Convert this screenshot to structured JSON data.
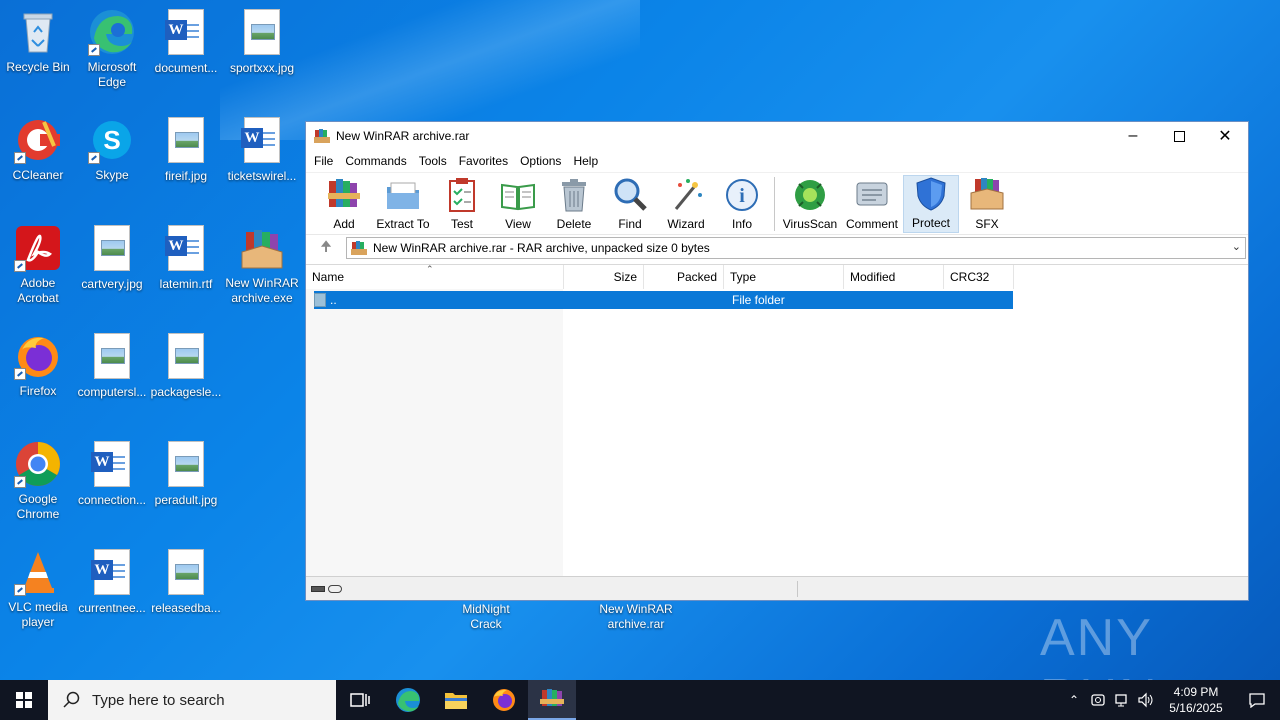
{
  "desktop": {
    "icons": [
      {
        "label": "Recycle Bin"
      },
      {
        "label": "Microsoft Edge"
      },
      {
        "label": "document..."
      },
      {
        "label": "sportxxx.jpg"
      },
      {
        "label": "CCleaner"
      },
      {
        "label": "Skype"
      },
      {
        "label": "fireif.jpg"
      },
      {
        "label": "ticketswirel..."
      },
      {
        "label": "Adobe Acrobat"
      },
      {
        "label": "cartvery.jpg"
      },
      {
        "label": "latemin.rtf"
      },
      {
        "label": "New WinRAR archive.exe"
      },
      {
        "label": "Firefox"
      },
      {
        "label": "computersl..."
      },
      {
        "label": "packagesle..."
      },
      {
        "label": "Google Chrome"
      },
      {
        "label": "connection..."
      },
      {
        "label": "peradult.jpg"
      },
      {
        "label": "VLC media player"
      },
      {
        "label": "currentnee..."
      },
      {
        "label": "releasedba..."
      },
      {
        "label": "MidNight Crack"
      },
      {
        "label": "New WinRAR archive.rar"
      }
    ]
  },
  "winrar": {
    "title": "New WinRAR archive.rar",
    "menu": [
      "File",
      "Commands",
      "Tools",
      "Favorites",
      "Options",
      "Help"
    ],
    "toolbar": [
      "Add",
      "Extract To",
      "Test",
      "View",
      "Delete",
      "Find",
      "Wizard",
      "Info",
      "VirusScan",
      "Comment",
      "Protect",
      "SFX"
    ],
    "address": "New WinRAR archive.rar - RAR archive, unpacked size 0 bytes",
    "columns": [
      "Name",
      "Size",
      "Packed",
      "Type",
      "Modified",
      "CRC32"
    ],
    "rows": [
      {
        "name": "..",
        "type": "File folder"
      }
    ]
  },
  "taskbar": {
    "search_placeholder": "Type here to search",
    "time": "4:09 PM",
    "date": "5/16/2025"
  },
  "watermark": "ANY RUN"
}
